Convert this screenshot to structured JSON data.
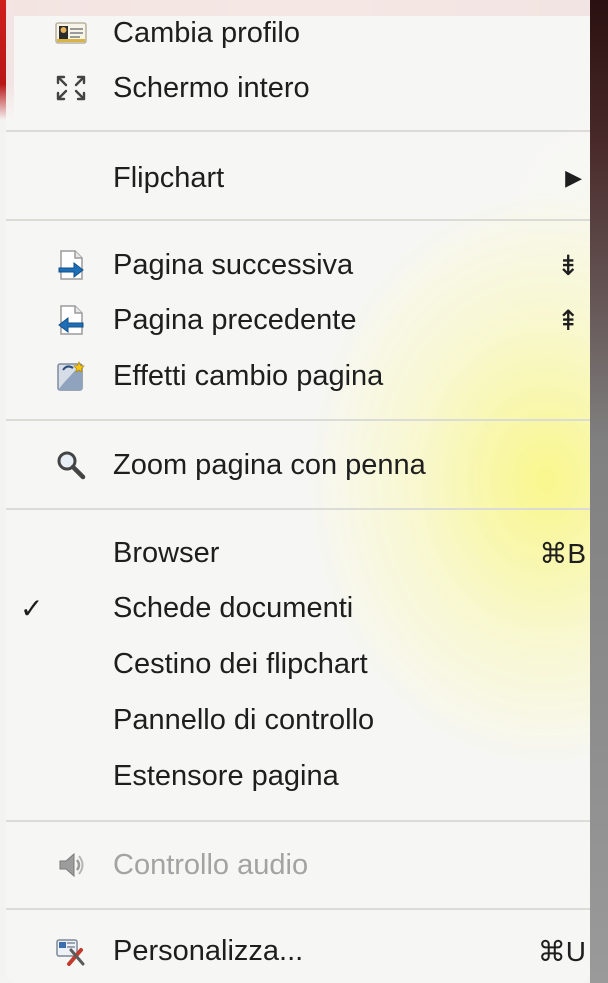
{
  "menu": {
    "items": [
      {
        "label": "Cambia profilo",
        "icon": "profile-card-icon"
      },
      {
        "label": "Schermo intero",
        "icon": "fullscreen-icon"
      },
      {
        "label": "Flipchart",
        "submenu_arrow": "▶"
      },
      {
        "label": "Pagina successiva",
        "icon": "next-page-icon",
        "shortcut": "⇟"
      },
      {
        "label": "Pagina precedente",
        "icon": "previous-page-icon",
        "shortcut": "⇞"
      },
      {
        "label": "Effetti cambio pagina",
        "icon": "page-transition-icon"
      },
      {
        "label": "Zoom pagina con penna",
        "icon": "magnifier-icon"
      },
      {
        "label": "Browser",
        "shortcut": "⌘B"
      },
      {
        "label": "Schede documenti",
        "checked": true,
        "check_mark": "✓"
      },
      {
        "label": "Cestino dei flipchart"
      },
      {
        "label": "Pannello di controllo"
      },
      {
        "label": "Estensore pagina"
      },
      {
        "label": "Controllo audio",
        "icon": "speaker-icon",
        "disabled": true
      },
      {
        "label": "Personalizza...",
        "icon": "customize-icon",
        "shortcut": "⌘U"
      }
    ]
  },
  "colors": {
    "text": "#1e1e1e",
    "disabled_text": "#a3a3a3",
    "separator": "#dcdcd6",
    "highlight_yellow": "#f6f35a",
    "top_red": "#d0201c"
  }
}
